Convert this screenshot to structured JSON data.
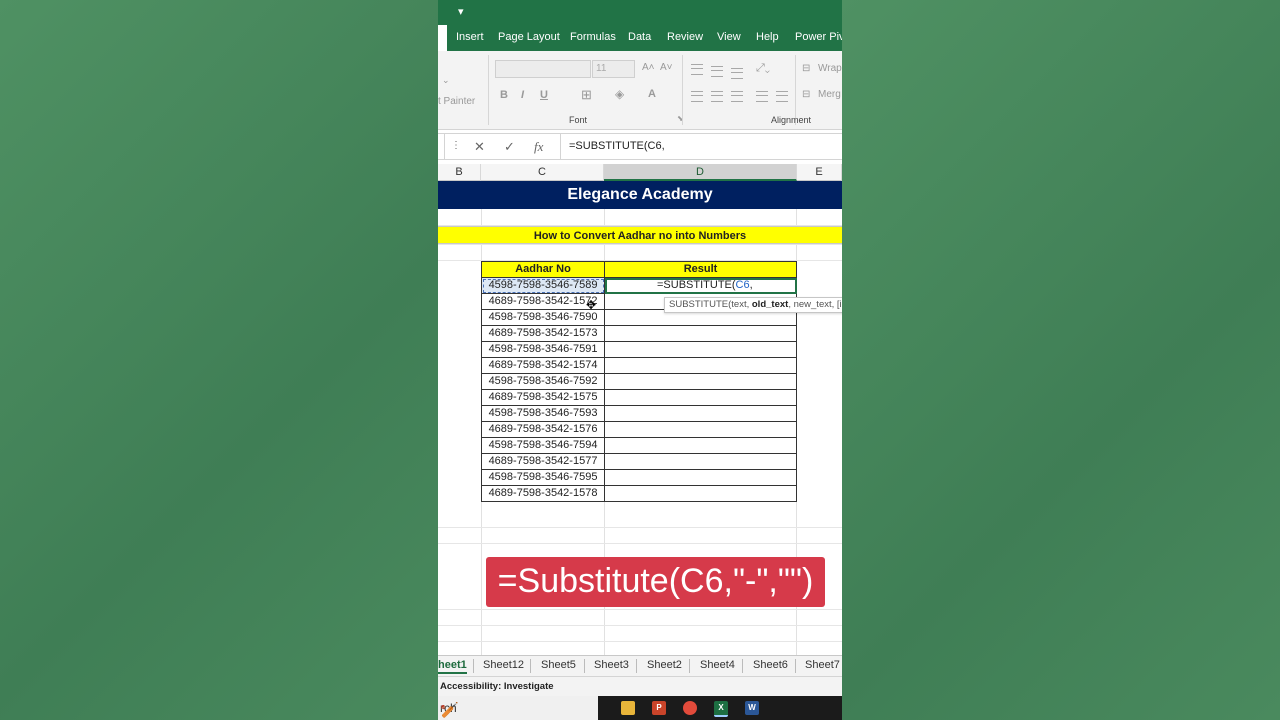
{
  "titlebar": {
    "qa_glyph": "▾"
  },
  "ribbon_tabs": [
    "Insert",
    "Page Layout",
    "Formulas",
    "Data",
    "Review",
    "View",
    "Help",
    "Power Pivot"
  ],
  "ribbon": {
    "painter_label": "t Painter",
    "font_size": "11",
    "bold": "B",
    "italic": "I",
    "underline": "U",
    "font_group_label": "Font",
    "alignment_group_label": "Alignment",
    "wrap_label": "Wrap",
    "merge_label": "Merg",
    "font_color_glyph": "A"
  },
  "formula_bar": {
    "cancel_glyph": "✕",
    "enter_glyph": "✓",
    "fx_glyph": "fx",
    "formula": "=SUBSTITUTE(C6,"
  },
  "columns": [
    "B",
    "C",
    "D",
    "E"
  ],
  "sheet": {
    "banner_title": "Elegance Academy",
    "subtitle": "How to Convert Aadhar no into Numbers",
    "table_headers": [
      "Aadhar No",
      "Result"
    ],
    "aadhar_numbers": [
      "4598-7598-3546-7589",
      "4689-7598-3542-1572",
      "4598-7598-3546-7590",
      "4689-7598-3542-1573",
      "4598-7598-3546-7591",
      "4689-7598-3542-1574",
      "4598-7598-3546-7592",
      "4689-7598-3542-1575",
      "4598-7598-3546-7593",
      "4689-7598-3542-1576",
      "4598-7598-3546-7594",
      "4689-7598-3542-1577",
      "4598-7598-3546-7595",
      "4689-7598-3542-1578"
    ],
    "editing_cell": {
      "prefix": "=SUBSTITUTE(",
      "ref": "C6",
      "suffix": ","
    },
    "tooltip": {
      "prefix": "SUBSTITUTE(text, ",
      "bold_arg": "old_text",
      "suffix": ", new_text, [in"
    }
  },
  "overlay_formula": "=Substitute(C6,\"-\",\"\")",
  "sheet_tabs": [
    "heet1",
    "Sheet12",
    "Sheet5",
    "Sheet3",
    "Sheet2",
    "Sheet4",
    "Sheet6",
    "Sheet7"
  ],
  "status": {
    "accessibility": "Accessibility: Investigate"
  },
  "taskbar": {
    "search_text": "rch"
  },
  "colors": {
    "excel_green": "#217346",
    "banner_navy": "#002060",
    "highlight_yellow": "#ffff00",
    "overlay_red": "#d63a4a"
  }
}
